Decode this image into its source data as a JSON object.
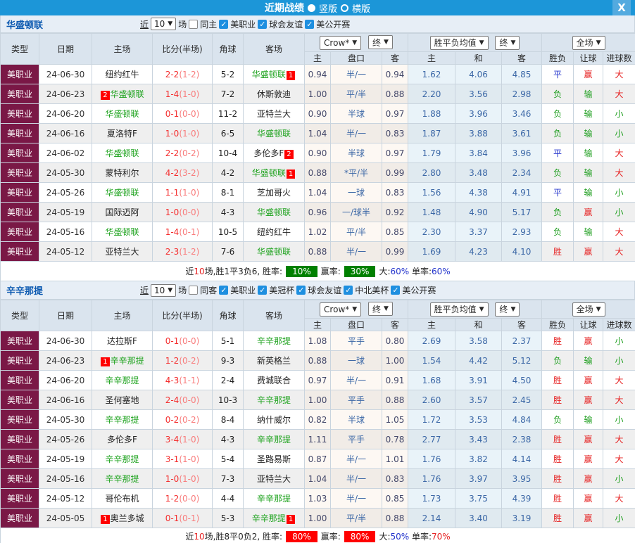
{
  "colors": {
    "red": "#e62222",
    "green": "#1e9e1e",
    "blue": "#2233cc",
    "badge_red": "#ff0000",
    "summary_green": "#008000",
    "summary_red": "#ff0000"
  },
  "titlebar": {
    "title": "近期战绩",
    "radio_vertical": "竖版",
    "radio_horizontal": "横版",
    "close_icon": "X"
  },
  "header": {
    "col_type": "类型",
    "col_date": "日期",
    "col_home": "主场",
    "col_score": "比分(半场)",
    "col_corner": "角球",
    "col_away": "客场",
    "odds_provider": "Crow*",
    "final1": "终",
    "sub_home": "主",
    "sub_handicap": "盘口",
    "sub_away": "客",
    "europe_select": "胜平负均值",
    "final2": "终",
    "sub_e_home": "主",
    "sub_e_draw": "和",
    "sub_e_away": "客",
    "scope_select": "全场",
    "sub_wl": "胜负",
    "sub_letgoal": "让球",
    "sub_goals": "进球数"
  },
  "sections": [
    {
      "team": "华盛顿联",
      "filter": {
        "jin": "近",
        "games": "10",
        "chang": "场",
        "same_label": "同主",
        "same_checked": false,
        "leagues": [
          "美职业",
          "球会友谊",
          "美公开赛"
        ]
      },
      "rows": [
        {
          "league": "美职业",
          "date": "24-06-30",
          "home": {
            "name": "纽约红牛"
          },
          "score": "2-2",
          "half": "(1-2)",
          "corner": "5-2",
          "away": {
            "name": "华盛顿联",
            "green": true,
            "badge": "1",
            "badge_pos": "after"
          },
          "asia": [
            "0.94",
            "半/一",
            "0.94"
          ],
          "euro": [
            "1.62",
            "4.06",
            "4.85"
          ],
          "results": [
            "平",
            "赢",
            "大"
          ]
        },
        {
          "league": "美职业",
          "date": "24-06-23",
          "home": {
            "name": "华盛顿联",
            "green": true,
            "badge": "2",
            "badge_pos": "before"
          },
          "score": "1-4",
          "half": "(1-0)",
          "corner": "7-2",
          "away": {
            "name": "休斯敦迪"
          },
          "asia": [
            "1.00",
            "平/半",
            "0.88"
          ],
          "euro": [
            "2.20",
            "3.56",
            "2.98"
          ],
          "results": [
            "负",
            "输",
            "大"
          ]
        },
        {
          "league": "美职业",
          "date": "24-06-20",
          "home": {
            "name": "华盛顿联",
            "green": true
          },
          "score": "0-1",
          "half": "(0-0)",
          "corner": "11-2",
          "away": {
            "name": "亚特兰大"
          },
          "asia": [
            "0.90",
            "半球",
            "0.97"
          ],
          "euro": [
            "1.88",
            "3.96",
            "3.46"
          ],
          "results": [
            "负",
            "输",
            "小"
          ]
        },
        {
          "league": "美职业",
          "date": "24-06-16",
          "home": {
            "name": "夏洛特F"
          },
          "score": "1-0",
          "half": "(1-0)",
          "corner": "6-5",
          "away": {
            "name": "华盛顿联",
            "green": true
          },
          "asia": [
            "1.04",
            "半/一",
            "0.83"
          ],
          "euro": [
            "1.87",
            "3.88",
            "3.61"
          ],
          "results": [
            "负",
            "输",
            "小"
          ]
        },
        {
          "league": "美职业",
          "date": "24-06-02",
          "home": {
            "name": "华盛顿联",
            "green": true
          },
          "score": "2-2",
          "half": "(0-2)",
          "corner": "10-4",
          "away": {
            "name": "多伦多F",
            "badge": "2",
            "badge_pos": "after"
          },
          "asia": [
            "0.90",
            "半球",
            "0.97"
          ],
          "euro": [
            "1.79",
            "3.84",
            "3.96"
          ],
          "results": [
            "平",
            "输",
            "大"
          ]
        },
        {
          "league": "美职业",
          "date": "24-05-30",
          "home": {
            "name": "蒙特利尔"
          },
          "score": "4-2",
          "half": "(3-2)",
          "corner": "4-2",
          "away": {
            "name": "华盛顿联",
            "green": true,
            "badge": "1",
            "badge_pos": "after"
          },
          "asia": [
            "0.88",
            "*平/半",
            "0.99"
          ],
          "euro": [
            "2.80",
            "3.48",
            "2.34"
          ],
          "results": [
            "负",
            "输",
            "大"
          ]
        },
        {
          "league": "美职业",
          "date": "24-05-26",
          "home": {
            "name": "华盛顿联",
            "green": true
          },
          "score": "1-1",
          "half": "(1-0)",
          "corner": "8-1",
          "away": {
            "name": "芝加哥火"
          },
          "asia": [
            "1.04",
            "一球",
            "0.83"
          ],
          "euro": [
            "1.56",
            "4.38",
            "4.91"
          ],
          "results": [
            "平",
            "输",
            "小"
          ]
        },
        {
          "league": "美职业",
          "date": "24-05-19",
          "home": {
            "name": "国际迈阿"
          },
          "score": "1-0",
          "half": "(0-0)",
          "corner": "4-3",
          "away": {
            "name": "华盛顿联",
            "green": true
          },
          "asia": [
            "0.96",
            "一/球半",
            "0.92"
          ],
          "euro": [
            "1.48",
            "4.90",
            "5.17"
          ],
          "results": [
            "负",
            "赢",
            "小"
          ]
        },
        {
          "league": "美职业",
          "date": "24-05-16",
          "home": {
            "name": "华盛顿联",
            "green": true
          },
          "score": "1-4",
          "half": "(0-1)",
          "corner": "10-5",
          "away": {
            "name": "纽约红牛"
          },
          "asia": [
            "1.02",
            "平/半",
            "0.85"
          ],
          "euro": [
            "2.30",
            "3.37",
            "2.93"
          ],
          "results": [
            "负",
            "输",
            "大"
          ]
        },
        {
          "league": "美职业",
          "date": "24-05-12",
          "home": {
            "name": "亚特兰大"
          },
          "score": "2-3",
          "half": "(1-2)",
          "corner": "7-6",
          "away": {
            "name": "华盛顿联",
            "green": true
          },
          "asia": [
            "0.88",
            "半/一",
            "0.99"
          ],
          "euro": [
            "1.69",
            "4.23",
            "4.10"
          ],
          "results": [
            "胜",
            "赢",
            "大"
          ]
        }
      ],
      "summary": {
        "parts": [
          {
            "text": "近",
            "color": "#222"
          },
          {
            "text": "10",
            "color": "#e62222"
          },
          {
            "text": "场,胜1平3负6, 胜率:",
            "color": "#222"
          }
        ],
        "rate1": {
          "value": "10%",
          "bg": "#008000"
        },
        "label2": "赢率:",
        "rate2": {
          "value": "30%",
          "bg": "#008000"
        },
        "tail": [
          {
            "text": "大:",
            "color": "#222"
          },
          {
            "text": "60%",
            "color": "#2233cc"
          },
          {
            "text": " 单率:",
            "color": "#222"
          },
          {
            "text": "60%",
            "color": "#2233cc"
          }
        ]
      }
    },
    {
      "team": "辛辛那提",
      "filter": {
        "jin": "近",
        "games": "10",
        "chang": "场",
        "same_label": "同客",
        "same_checked": false,
        "leagues": [
          "美职业",
          "美冠杯",
          "球会友谊",
          "中北美杯",
          "美公开赛"
        ]
      },
      "rows": [
        {
          "league": "美职业",
          "date": "24-06-30",
          "home": {
            "name": "达拉斯F"
          },
          "score": "0-1",
          "half": "(0-0)",
          "corner": "5-1",
          "away": {
            "name": "辛辛那提",
            "green": true
          },
          "asia": [
            "1.08",
            "平手",
            "0.80"
          ],
          "euro": [
            "2.69",
            "3.58",
            "2.37"
          ],
          "results": [
            "胜",
            "赢",
            "小"
          ]
        },
        {
          "league": "美职业",
          "date": "24-06-23",
          "home": {
            "name": "辛辛那提",
            "green": true,
            "badge": "1",
            "badge_pos": "before"
          },
          "score": "1-2",
          "half": "(0-2)",
          "corner": "9-3",
          "away": {
            "name": "新英格兰"
          },
          "asia": [
            "0.88",
            "一球",
            "1.00"
          ],
          "euro": [
            "1.54",
            "4.42",
            "5.12"
          ],
          "results": [
            "负",
            "输",
            "小"
          ]
        },
        {
          "league": "美职业",
          "date": "24-06-20",
          "home": {
            "name": "辛辛那提",
            "green": true
          },
          "score": "4-3",
          "half": "(1-1)",
          "corner": "2-4",
          "away": {
            "name": "费城联合"
          },
          "asia": [
            "0.97",
            "半/一",
            "0.91"
          ],
          "euro": [
            "1.68",
            "3.91",
            "4.50"
          ],
          "results": [
            "胜",
            "赢",
            "大"
          ]
        },
        {
          "league": "美职业",
          "date": "24-06-16",
          "home": {
            "name": "圣何塞地"
          },
          "score": "2-4",
          "half": "(0-0)",
          "corner": "10-3",
          "away": {
            "name": "辛辛那提",
            "green": true
          },
          "asia": [
            "1.00",
            "平手",
            "0.88"
          ],
          "euro": [
            "2.60",
            "3.57",
            "2.45"
          ],
          "results": [
            "胜",
            "赢",
            "大"
          ]
        },
        {
          "league": "美职业",
          "date": "24-05-30",
          "home": {
            "name": "辛辛那提",
            "green": true
          },
          "score": "0-2",
          "half": "(0-2)",
          "corner": "8-4",
          "away": {
            "name": "纳什威尔"
          },
          "asia": [
            "0.82",
            "半球",
            "1.05"
          ],
          "euro": [
            "1.72",
            "3.53",
            "4.84"
          ],
          "results": [
            "负",
            "输",
            "小"
          ]
        },
        {
          "league": "美职业",
          "date": "24-05-26",
          "home": {
            "name": "多伦多F"
          },
          "score": "3-4",
          "half": "(1-0)",
          "corner": "4-3",
          "away": {
            "name": "辛辛那提",
            "green": true
          },
          "asia": [
            "1.11",
            "平手",
            "0.78"
          ],
          "euro": [
            "2.77",
            "3.43",
            "2.38"
          ],
          "results": [
            "胜",
            "赢",
            "大"
          ]
        },
        {
          "league": "美职业",
          "date": "24-05-19",
          "home": {
            "name": "辛辛那提",
            "green": true
          },
          "score": "3-1",
          "half": "(1-0)",
          "corner": "5-4",
          "away": {
            "name": "圣路易斯"
          },
          "asia": [
            "0.87",
            "半/一",
            "1.01"
          ],
          "euro": [
            "1.76",
            "3.82",
            "4.14"
          ],
          "results": [
            "胜",
            "赢",
            "大"
          ]
        },
        {
          "league": "美职业",
          "date": "24-05-16",
          "home": {
            "name": "辛辛那提",
            "green": true
          },
          "score": "1-0",
          "half": "(1-0)",
          "corner": "7-3",
          "away": {
            "name": "亚特兰大"
          },
          "asia": [
            "1.04",
            "半/一",
            "0.83"
          ],
          "euro": [
            "1.76",
            "3.97",
            "3.95"
          ],
          "results": [
            "胜",
            "赢",
            "小"
          ]
        },
        {
          "league": "美职业",
          "date": "24-05-12",
          "home": {
            "name": "哥伦布机"
          },
          "score": "1-2",
          "half": "(0-0)",
          "corner": "4-4",
          "away": {
            "name": "辛辛那提",
            "green": true
          },
          "asia": [
            "1.03",
            "半/一",
            "0.85"
          ],
          "euro": [
            "1.73",
            "3.75",
            "4.39"
          ],
          "results": [
            "胜",
            "赢",
            "大"
          ]
        },
        {
          "league": "美职业",
          "date": "24-05-05",
          "home": {
            "name": "奥兰多城",
            "badge": "1",
            "badge_pos": "before"
          },
          "score": "0-1",
          "half": "(0-1)",
          "corner": "5-3",
          "away": {
            "name": "辛辛那提",
            "green": true,
            "badge": "1",
            "badge_pos": "after"
          },
          "asia": [
            "1.00",
            "平/半",
            "0.88"
          ],
          "euro": [
            "2.14",
            "3.40",
            "3.19"
          ],
          "results": [
            "胜",
            "赢",
            "小"
          ]
        }
      ],
      "summary": {
        "parts": [
          {
            "text": "近",
            "color": "#222"
          },
          {
            "text": "10",
            "color": "#e62222"
          },
          {
            "text": "场,胜8平0负2, 胜率:",
            "color": "#222"
          }
        ],
        "rate1": {
          "value": "80%",
          "bg": "#ff0000"
        },
        "label2": "赢率:",
        "rate2": {
          "value": "80%",
          "bg": "#ff0000"
        },
        "tail": [
          {
            "text": "大:",
            "color": "#222"
          },
          {
            "text": "50%",
            "color": "#2233cc"
          },
          {
            "text": " 单率:",
            "color": "#222"
          },
          {
            "text": "70%",
            "color": "#e62222"
          }
        ]
      }
    }
  ]
}
